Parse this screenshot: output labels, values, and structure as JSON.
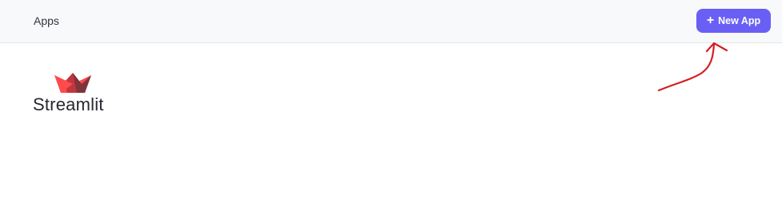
{
  "topbar": {
    "apps_label": "Apps",
    "new_app_button": {
      "label": "New App",
      "icon": "plus-icon",
      "color": "#6a5ff5"
    }
  },
  "logo": {
    "text": "Streamlit",
    "icon": "streamlit-boat-logo",
    "colors": [
      "#ff4b4b",
      "#c2353f",
      "#7d353b"
    ]
  },
  "annotation": {
    "type": "red-arrow",
    "color": "#d42020"
  }
}
